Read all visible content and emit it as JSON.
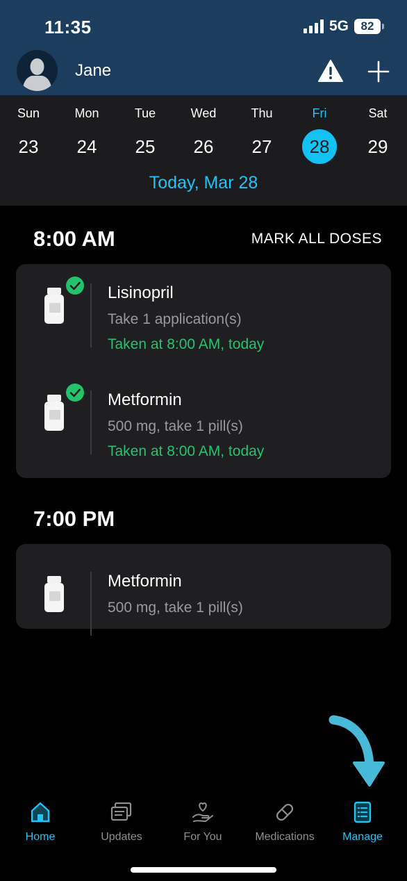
{
  "status_bar": {
    "time": "11:35",
    "network": "5G",
    "battery": "82"
  },
  "header": {
    "user_name": "Jane"
  },
  "week": {
    "days": [
      {
        "name": "Sun",
        "number": "23"
      },
      {
        "name": "Mon",
        "number": "24"
      },
      {
        "name": "Tue",
        "number": "25"
      },
      {
        "name": "Wed",
        "number": "26"
      },
      {
        "name": "Thu",
        "number": "27"
      },
      {
        "name": "Fri",
        "number": "28"
      },
      {
        "name": "Sat",
        "number": "29"
      }
    ],
    "selected_day": "Fri",
    "today_label": "Today, Mar 28"
  },
  "schedule": {
    "mark_all_label": "MARK ALL DOSES",
    "groups": [
      {
        "time": "8:00 AM",
        "doses": [
          {
            "name": "Lisinopril",
            "detail": "Take 1 application(s)",
            "status": "Taken at 8:00 AM, today",
            "taken": true
          },
          {
            "name": "Metformin",
            "detail": "500 mg, take 1 pill(s)",
            "status": "Taken at 8:00 AM, today",
            "taken": true
          }
        ]
      },
      {
        "time": "7:00 PM",
        "doses": [
          {
            "name": "Metformin",
            "detail": "500 mg, take 1 pill(s)",
            "taken": false
          }
        ]
      }
    ]
  },
  "tabbar": {
    "tabs": [
      {
        "label": "Home",
        "icon": "home-icon",
        "active": true
      },
      {
        "label": "Updates",
        "icon": "updates-icon",
        "active": false
      },
      {
        "label": "For You",
        "icon": "heart-hand-icon",
        "active": false
      },
      {
        "label": "Medications",
        "icon": "pill-icon",
        "active": false
      },
      {
        "label": "Manage",
        "icon": "list-icon",
        "active": true
      }
    ]
  },
  "colors": {
    "header_bg": "#1c3d5e",
    "accent": "#22c2f2",
    "taken_green": "#24c46f",
    "card_bg": "#1f1f21"
  }
}
